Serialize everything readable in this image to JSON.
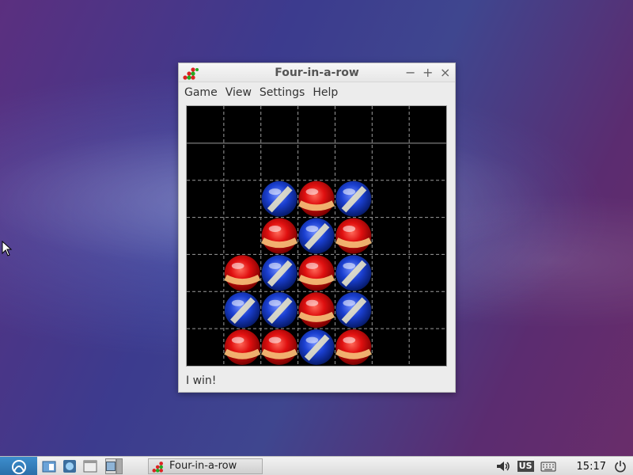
{
  "window": {
    "title": "Four-in-a-row",
    "controls": {
      "minimize": "−",
      "maximize": "+",
      "close": "×"
    }
  },
  "menu": [
    "Game",
    "View",
    "Settings",
    "Help"
  ],
  "board": {
    "columns": 7,
    "rows": 7,
    "cells": [
      [
        ".",
        ".",
        ".",
        ".",
        ".",
        ".",
        "."
      ],
      [
        ".",
        ".",
        ".",
        ".",
        ".",
        ".",
        "."
      ],
      [
        ".",
        ".",
        "B",
        "R",
        "B",
        ".",
        "."
      ],
      [
        ".",
        ".",
        "R",
        "B",
        "R",
        ".",
        "."
      ],
      [
        ".",
        "R",
        "B",
        "R",
        "B",
        ".",
        "."
      ],
      [
        ".",
        "B",
        "B",
        "R",
        "B",
        ".",
        "."
      ],
      [
        ".",
        "R",
        "R",
        "B",
        "R",
        ".",
        "."
      ]
    ],
    "colors": {
      "red": "#e01010",
      "blue": "#1a3fd0",
      "board": "#000000",
      "grid": "#9a9a9a"
    }
  },
  "status": "I win!",
  "taskbar": {
    "task_label": "Four-in-a-row",
    "keyboard_layout": "US",
    "clock": "15:17"
  }
}
